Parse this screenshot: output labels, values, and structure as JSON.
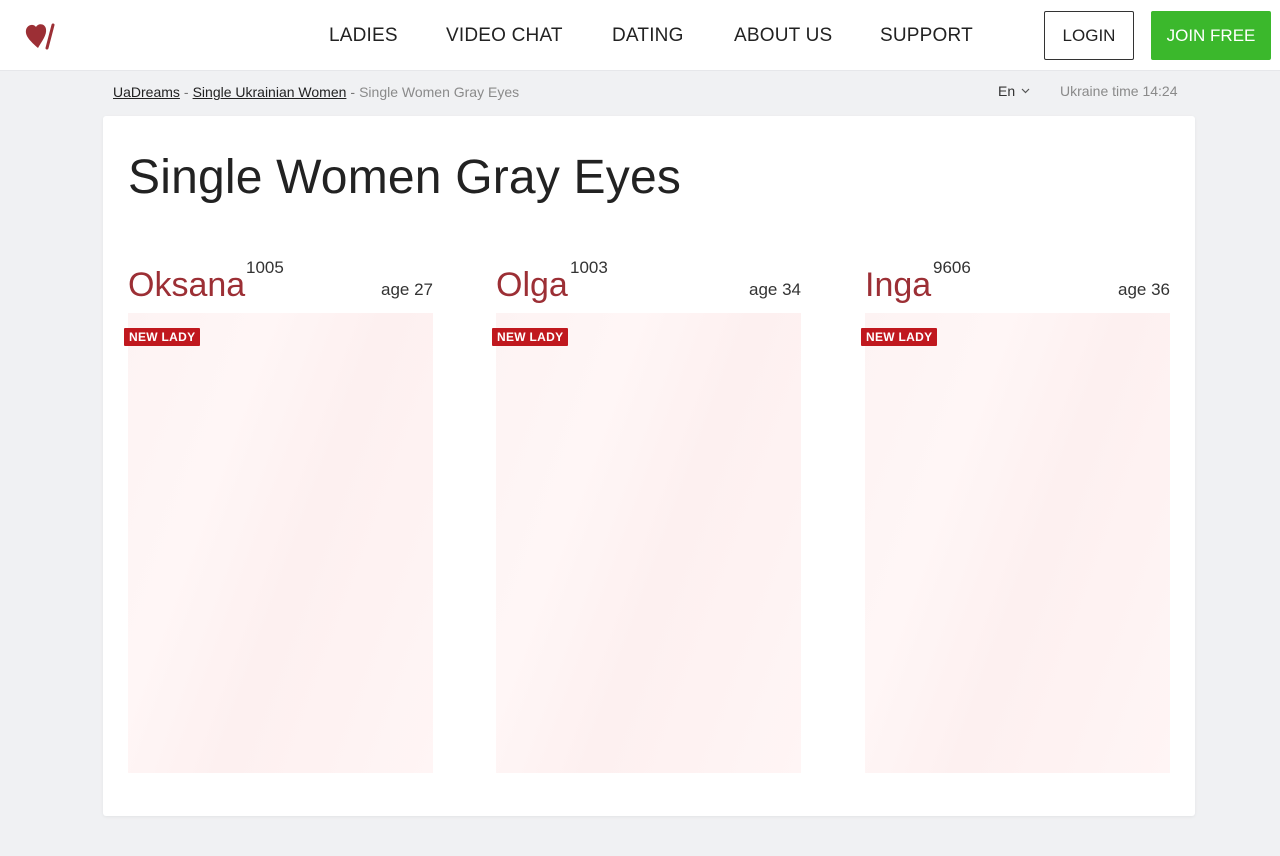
{
  "brand": {
    "logo_icon": "heart-slash-logo-icon",
    "accent": "#9c2f35"
  },
  "nav": {
    "items": [
      {
        "label": "LADIES"
      },
      {
        "label": "VIDEO CHAT"
      },
      {
        "label": "DATING"
      },
      {
        "label": "ABOUT US"
      },
      {
        "label": "SUPPORT"
      }
    ],
    "login_label": "LOGIN",
    "join_label": "JOIN FREE",
    "join_color": "#3bb82c"
  },
  "breadcrumb": {
    "items": [
      {
        "label": "UaDreams"
      },
      {
        "label": "Single Ukrainian Women"
      }
    ],
    "separator": "-",
    "current": "Single Women Gray Eyes"
  },
  "language": {
    "selected": "En",
    "icon": "chevron-down-icon"
  },
  "ukraine_time": "Ukraine time 14:24",
  "page_title": "Single Women Gray Eyes",
  "profiles": [
    {
      "name": "Oksana",
      "id": "1005",
      "age": "age 27",
      "badge": "NEW LADY"
    },
    {
      "name": "Olga",
      "id": "1003",
      "age": "age 34",
      "badge": "NEW LADY"
    },
    {
      "name": "Inga",
      "id": "9606",
      "age": "age 36",
      "badge": "NEW LADY"
    }
  ]
}
